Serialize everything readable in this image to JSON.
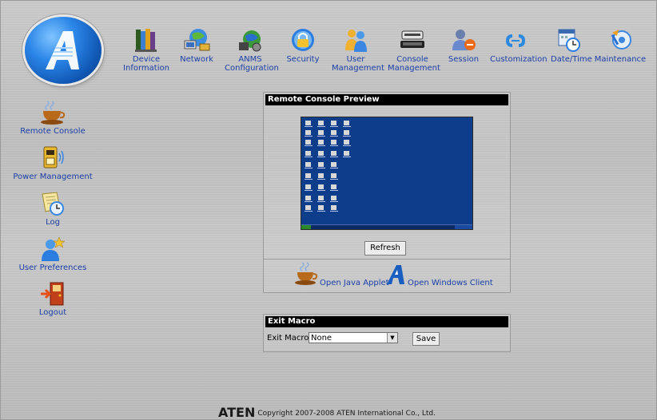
{
  "top_nav": [
    {
      "id": "device-information",
      "label": "Device Information",
      "icon": "books-icon"
    },
    {
      "id": "network",
      "label": "Network",
      "icon": "network-icon"
    },
    {
      "id": "anms-configuration",
      "label": "ANMS Configuration",
      "icon": "anms-icon"
    },
    {
      "id": "security",
      "label": "Security",
      "icon": "lock-icon"
    },
    {
      "id": "user-management",
      "label": "User Management",
      "icon": "users-icon"
    },
    {
      "id": "console-management",
      "label": "Console Management",
      "icon": "kvm-console-icon"
    },
    {
      "id": "session",
      "label": "Session",
      "icon": "session-icon"
    },
    {
      "id": "customization",
      "label": "Customization",
      "icon": "customization-icon"
    },
    {
      "id": "date-time",
      "label": "Date/Time",
      "icon": "calendar-clock-icon"
    },
    {
      "id": "maintenance",
      "label": "Maintenance",
      "icon": "maintenance-icon"
    }
  ],
  "left_nav": [
    {
      "id": "remote-console",
      "label": "Remote Console",
      "icon": "coffee-cup-icon"
    },
    {
      "id": "power-management",
      "label": "Power Management",
      "icon": "power-device-icon"
    },
    {
      "id": "log",
      "label": "Log",
      "icon": "log-clock-icon"
    },
    {
      "id": "user-preferences",
      "label": "User Preferences",
      "icon": "user-star-icon"
    },
    {
      "id": "logout",
      "label": "Logout",
      "icon": "exit-door-icon"
    }
  ],
  "preview": {
    "title": "Remote Console Preview",
    "refresh_label": "Refresh",
    "java_applet_label": "Open Java Applet",
    "windows_client_label": "Open Windows Client"
  },
  "exit_macro": {
    "title": "Exit Macro",
    "field_label": "Exit Macro:",
    "selected": "None",
    "save_label": "Save"
  },
  "footer": {
    "brand": "ATEN",
    "copyright": "Copyright 2007-2008 ATEN International Co., Ltd."
  },
  "colors": {
    "link_blue": "#1a3fa8",
    "panel_title_bg": "#000000",
    "desktop_blue": "#0e3d8c"
  }
}
